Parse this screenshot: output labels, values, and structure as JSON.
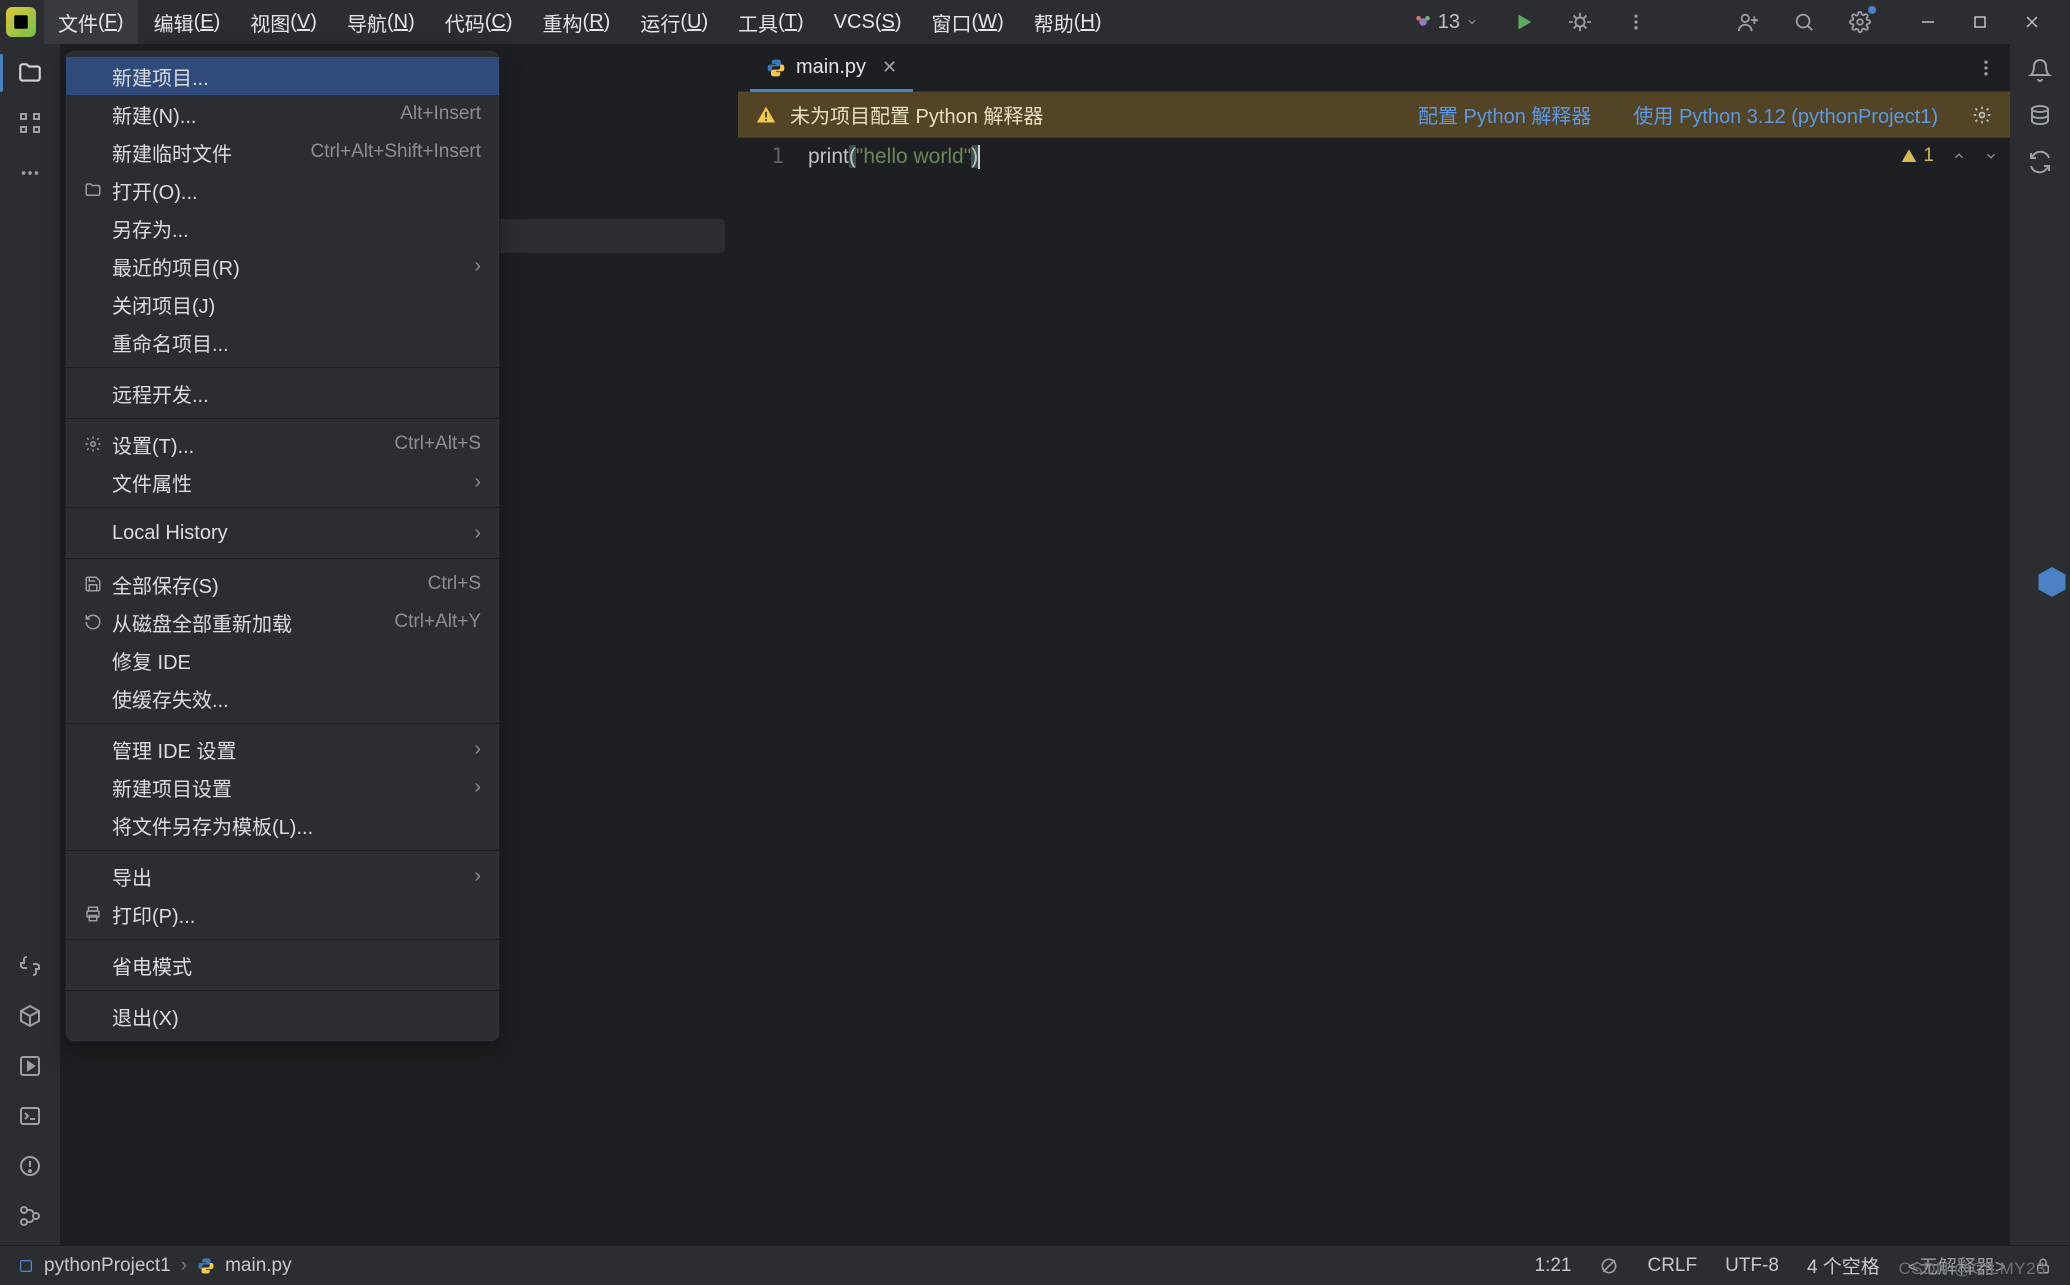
{
  "menubar": {
    "count": "13",
    "items": [
      {
        "base": "文件",
        "mn": "F"
      },
      {
        "base": "编辑",
        "mn": "E"
      },
      {
        "base": "视图",
        "mn": "V"
      },
      {
        "base": "导航",
        "mn": "N"
      },
      {
        "base": "代码",
        "mn": "C"
      },
      {
        "base": "重构",
        "mn": "R"
      },
      {
        "base": "运行",
        "mn": "U"
      },
      {
        "base": "工具",
        "mn": "T"
      },
      {
        "base": "VCS",
        "mn": "S",
        "plain": true
      },
      {
        "base": "窗口",
        "mn": "W"
      },
      {
        "base": "帮助",
        "mn": "H"
      }
    ]
  },
  "file_menu": {
    "new_project": "新建项目...",
    "new": "新建(",
    "new_mn": "N",
    "new_suffix": ")...",
    "new_hint": "Alt+Insert",
    "new_scratch": "新建临时文件",
    "new_scratch_hint": "Ctrl+Alt+Shift+Insert",
    "open": "打开(",
    "open_mn": "O",
    "open_suffix": ")...",
    "save_as": "另存为...",
    "recent": "最近的项目(",
    "recent_mn": "R",
    "recent_suffix": ")",
    "close_project": "关闭项目(",
    "close_mn": "J",
    "close_suffix": ")",
    "rename": "重命名项目...",
    "remote": "远程开发...",
    "settings": "设置(",
    "settings_mn": "T",
    "settings_suffix": ")...",
    "settings_hint": "Ctrl+Alt+S",
    "props": "文件属性",
    "local_history_pre": "Local ",
    "local_history_mn": "H",
    "local_history_post": "istory",
    "save_all": "全部保存(",
    "save_all_mn": "S",
    "save_all_suffix": ")",
    "save_all_hint": "Ctrl+S",
    "reload": "从磁盘全部重新加载",
    "reload_hint": "Ctrl+Alt+Y",
    "repair": "修复 IDE",
    "invalidate": "使缓存失效...",
    "manage_ide": "管理 IDE 设置",
    "new_proj_settings": "新建项目设置",
    "save_as_template": "将文件另存为模板(",
    "save_tmpl_mn": "L",
    "save_tmpl_suffix": ")...",
    "export": "导出",
    "print": "打印(",
    "print_mn": "P",
    "print_suffix": ")...",
    "power_save": "省电模式",
    "exit": "退出(",
    "exit_mn": "X",
    "exit_suffix": ")"
  },
  "tab": {
    "name": "main.py"
  },
  "banner": {
    "msg": "未为项目配置 Python 解释器",
    "link1": "配置 Python 解释器",
    "link2": "使用 Python 3.12 (pythonProject1)"
  },
  "code": {
    "line_no": "1",
    "tok_fn": "print",
    "tok_lpar": "(",
    "tok_str": "\"hello world\"",
    "tok_rpar": ")"
  },
  "inspections": {
    "warn_count": "1"
  },
  "statusbar": {
    "project": "pythonProject1",
    "file": "main.py",
    "pos": "1:21",
    "line_sep": "CRLF",
    "encoding": "UTF-8",
    "indent": "4 个空格",
    "interp": "<无解释器>"
  },
  "watermark": "CSDN @CILMY23"
}
